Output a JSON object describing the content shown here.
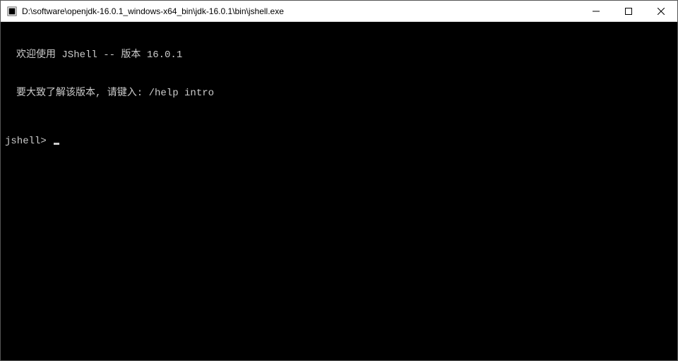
{
  "titlebar": {
    "title": "D:\\software\\openjdk-16.0.1_windows-x64_bin\\jdk-16.0.1\\bin\\jshell.exe"
  },
  "terminal": {
    "line1": "欢迎使用 JShell -- 版本 16.0.1",
    "line2": "要大致了解该版本, 请键入: /help intro",
    "prompt": "jshell>"
  }
}
